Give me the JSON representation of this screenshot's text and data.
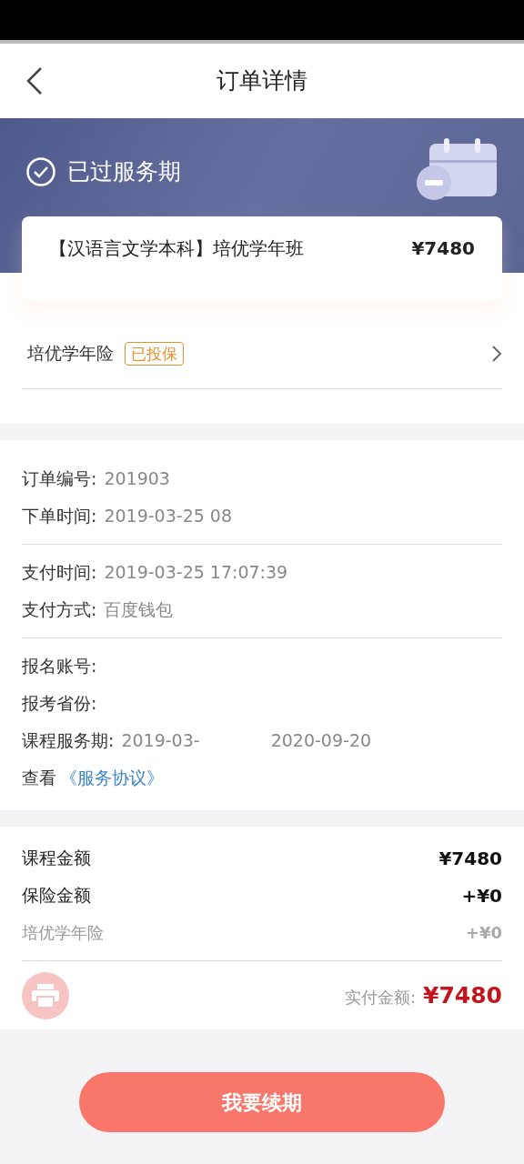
{
  "nav": {
    "title": "订单详情"
  },
  "status": {
    "label": "已过服务期"
  },
  "product": {
    "name": "【汉语言文学本科】培优学年班",
    "price": "¥7480"
  },
  "insurance": {
    "label": "培优学年险",
    "badge": "已投保"
  },
  "info_groups": [
    [
      {
        "label": "订单编号:",
        "values": [
          "201903"
        ]
      },
      {
        "label": "下单时间:",
        "values": [
          "2019-03-25 08"
        ]
      }
    ],
    [
      {
        "label": "支付时间:",
        "values": [
          "2019-03-25 17:07:39"
        ]
      },
      {
        "label": "支付方式:",
        "values": [
          "百度钱包"
        ]
      }
    ],
    [
      {
        "label": "报名账号:"
      },
      {
        "label": "报考省份:"
      },
      {
        "label": "课程服务期:",
        "values": [
          "2019-03-",
          "2020-09-20"
        ]
      }
    ]
  ],
  "agreement": {
    "prefix": "查看",
    "link": "《服务协议》"
  },
  "amounts": [
    {
      "kind": "main",
      "label": "课程金额",
      "value": "¥7480"
    },
    {
      "kind": "main",
      "label": "保险金额",
      "value": "+¥0"
    },
    {
      "kind": "sub",
      "label": "培优学年险",
      "value": "+¥0"
    }
  ],
  "total": {
    "label": "实付金额:",
    "value": "¥7480"
  },
  "renew_button": "我要续期"
}
